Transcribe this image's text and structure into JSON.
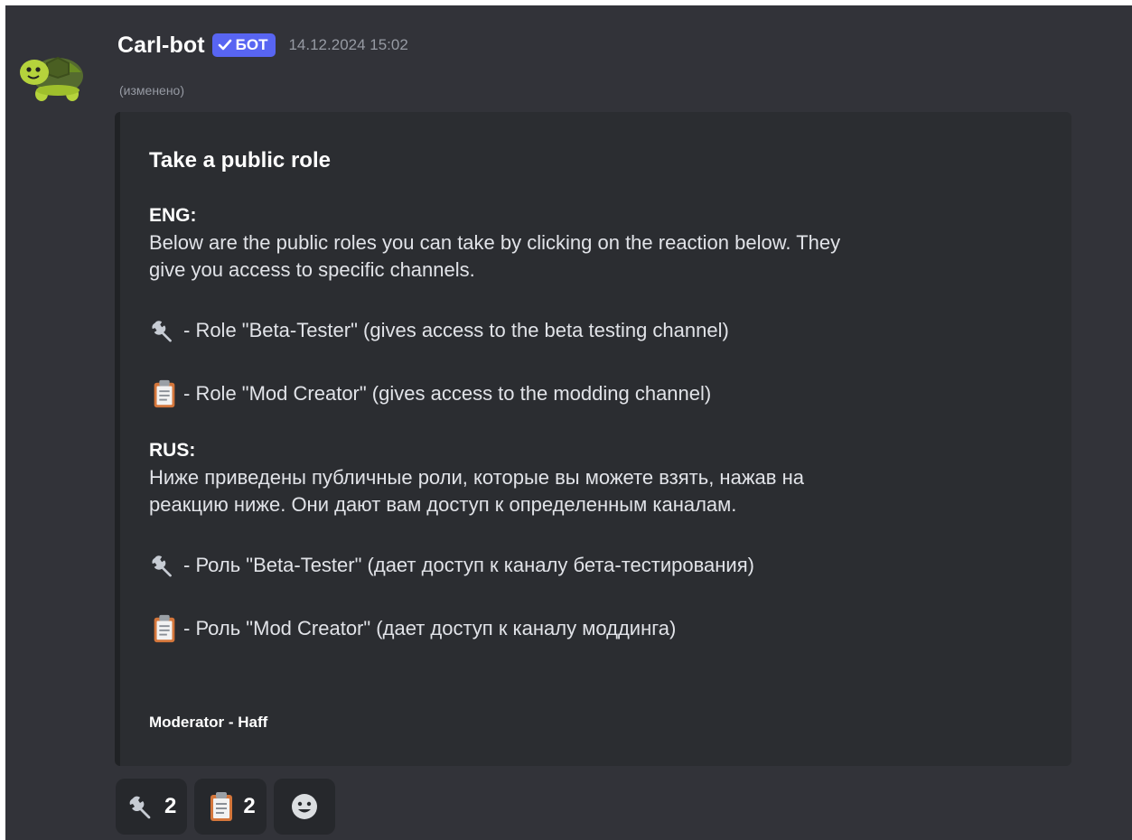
{
  "message": {
    "author": "Carl-bot",
    "bot_badge": "БОТ",
    "timestamp": "14.12.2024 15:02",
    "edited_label": "(изменено)"
  },
  "embed": {
    "title": "Take a public role",
    "eng_heading": "ENG:",
    "eng_text_1": "Below are the public roles you can take by clicking on the reaction below. They",
    "eng_text_2": "give you access to specific channels.",
    "eng_role_1": "- Role \"Beta-Tester\" (gives access to the beta testing channel)",
    "eng_role_2": "- Role \"Mod Creator\" (gives access to the modding channel)",
    "rus_heading": "RUS:",
    "rus_text_1": "Ниже приведены публичные роли, которые вы можете взять, нажав на",
    "rus_text_2": "реакцию ниже. Они дают вам доступ к определенным каналам.",
    "rus_role_1": "- Роль \"Beta-Tester\" (дает доступ к каналу бета-тестирования)",
    "rus_role_2": "- Роль \"Mod Creator\" (дает доступ к каналу моддинга)",
    "footer": "Moderator - Haff"
  },
  "reactions": [
    {
      "icon": "wrench-icon",
      "count": "2"
    },
    {
      "icon": "clipboard-icon",
      "count": "2"
    },
    {
      "icon": "add-reaction-icon"
    }
  ],
  "colors": {
    "background": "#323339",
    "embed_bg": "#2b2d31",
    "bot_badge": "#5865f2",
    "timestamp": "#969aa3"
  }
}
